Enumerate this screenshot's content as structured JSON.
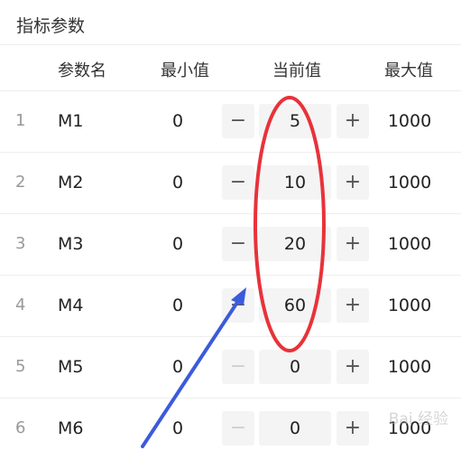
{
  "section": {
    "title": "指标参数"
  },
  "table": {
    "headers": {
      "name": "参数名",
      "min": "最小值",
      "current": "当前值",
      "max": "最大值"
    },
    "minus_label": "−",
    "plus_label": "+",
    "rows": [
      {
        "index": "1",
        "name": "M1",
        "min": "0",
        "current": "5",
        "max": "1000",
        "minus_enabled": true
      },
      {
        "index": "2",
        "name": "M2",
        "min": "0",
        "current": "10",
        "max": "1000",
        "minus_enabled": true
      },
      {
        "index": "3",
        "name": "M3",
        "min": "0",
        "current": "20",
        "max": "1000",
        "minus_enabled": true
      },
      {
        "index": "4",
        "name": "M4",
        "min": "0",
        "current": "60",
        "max": "1000",
        "minus_enabled": true
      },
      {
        "index": "5",
        "name": "M5",
        "min": "0",
        "current": "0",
        "max": "1000",
        "minus_enabled": false
      },
      {
        "index": "6",
        "name": "M6",
        "min": "0",
        "current": "0",
        "max": "1000",
        "minus_enabled": false
      }
    ]
  },
  "annotation": {
    "ellipse_color": "#e8323a",
    "arrow_color": "#3b5bdb"
  },
  "watermark": {
    "text": "Bai 经验"
  }
}
